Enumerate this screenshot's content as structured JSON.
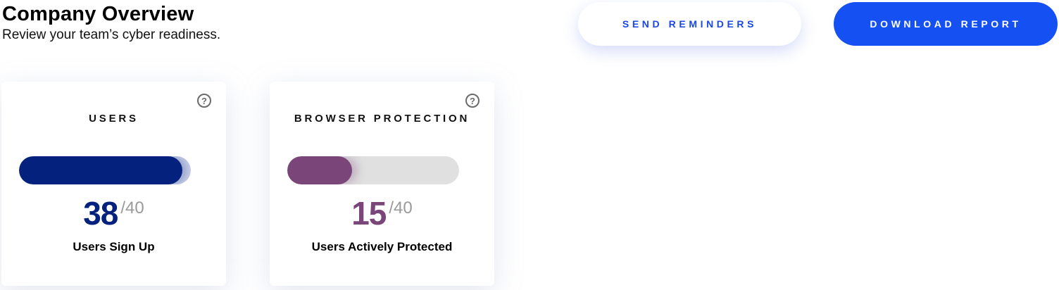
{
  "header": {
    "title": "Company Overview",
    "subtitle": "Review your team’s cyber readiness."
  },
  "actions": {
    "send_reminders_label": "SEND REMINDERS",
    "download_report_label": "DOWNLOAD REPORT"
  },
  "cards": [
    {
      "title": "USERS",
      "help_icon": "question-circle-icon",
      "value": "38",
      "total": "/40",
      "progress_fraction": 0.95,
      "label": "Users Sign Up",
      "color": "#04217e",
      "track_color": "#c7cee6"
    },
    {
      "title": "BROWSER PROTECTION",
      "help_icon": "question-circle-icon",
      "value": "15",
      "total": "/40",
      "progress_fraction": 0.375,
      "label": "Users Actively Protected",
      "color": "#7a4578",
      "track_color": "#e0e0e0"
    }
  ],
  "colors": {
    "primary_button": "#1550f3",
    "secondary_button_text": "#1a47e6"
  }
}
